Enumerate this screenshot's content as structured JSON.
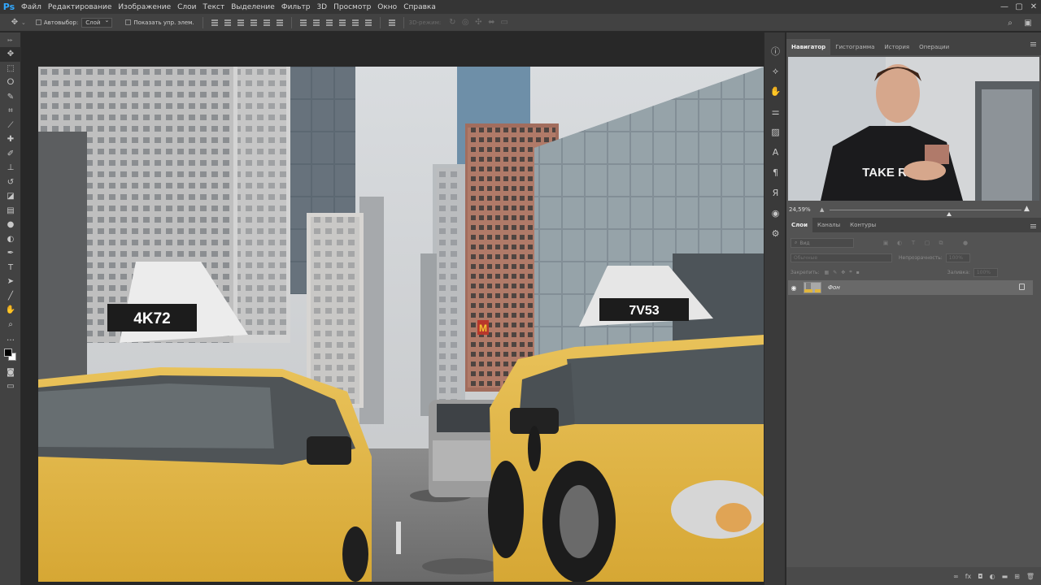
{
  "app": {
    "logo": "Ps"
  },
  "menu": [
    "Файл",
    "Редактирование",
    "Изображение",
    "Слои",
    "Текст",
    "Выделение",
    "Фильтр",
    "3D",
    "Просмотр",
    "Окно",
    "Справка"
  ],
  "window_controls": {
    "minimize": "—",
    "maximize": "▢",
    "close": "✕"
  },
  "options": {
    "auto_select_label": "Автовыбор:",
    "auto_select_value": "Слой",
    "show_controls_label": "Показать упр. элем.",
    "mode_3d_label": "3D-режим:"
  },
  "tools": [
    "move",
    "marquee",
    "lasso",
    "quick-select",
    "crop",
    "eyedropper",
    "healing",
    "brush",
    "stamp",
    "history-brush",
    "eraser",
    "gradient",
    "blur",
    "dodge",
    "pen",
    "type",
    "path-select",
    "shape",
    "hand",
    "zoom",
    "more"
  ],
  "right_strip_icons": [
    "info-icon",
    "paths-icon",
    "brush-presets-icon",
    "adjust-icon",
    "image-icon",
    "character-icon",
    "paragraph-icon",
    "glyph-icon",
    "camera-icon",
    "properties-icon"
  ],
  "navigator": {
    "tabs": [
      "Навигатор",
      "Гистограмма",
      "История",
      "Операции"
    ],
    "active_tab": 0,
    "zoom": "24,59%"
  },
  "layers_panel": {
    "tabs": [
      "Слои",
      "Каналы",
      "Контуры"
    ],
    "active_tab": 0,
    "kind_placeholder": "Вид",
    "blend_mode": "Обычные",
    "opacity_label": "Непрозрачность:",
    "opacity_value": "100%",
    "lock_label": "Закрепить:",
    "fill_label": "Заливка:",
    "fill_value": "100%",
    "layer": {
      "name": "Фон",
      "visible": true,
      "locked": true
    }
  },
  "image": {
    "taxi_left_roof": "4K72",
    "taxi_right_roof": "7V53",
    "logo_m": "M",
    "webcam_shirt_text": "TAKE RATES"
  },
  "colors": {
    "accent": "#31a8ff",
    "taxi_yellow": "#e0b63e",
    "panel_bg": "#535353"
  }
}
